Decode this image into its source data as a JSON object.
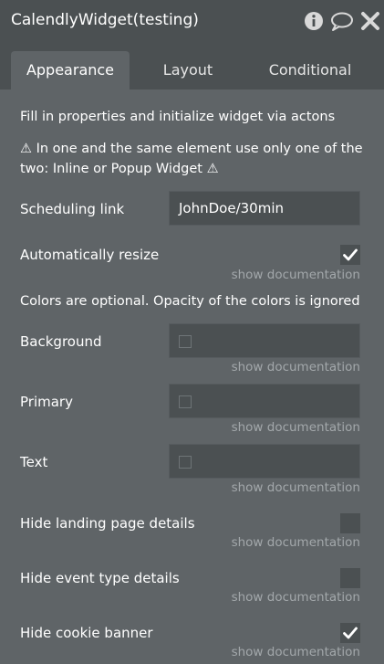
{
  "window": {
    "title": "CalendlyWidget(testing)",
    "icons": [
      "info-icon",
      "chat-icon",
      "close-icon"
    ]
  },
  "tabs": [
    {
      "label": "Appearance",
      "active": true
    },
    {
      "label": "Layout",
      "active": false
    },
    {
      "label": "Conditional",
      "active": false
    }
  ],
  "intro": {
    "line1": "Fill in properties and initialize widget via actons",
    "warning_line1": "⚠ In one and the same element use only one of the",
    "warning_line2": "two: Inline or Popup Widget ⚠"
  },
  "fields": {
    "scheduling_link": {
      "label": "Scheduling link",
      "value": "JohnDoe/30min"
    },
    "auto_resize": {
      "label": "Automatically resize",
      "checked": true,
      "doc": "show documentation"
    },
    "colors_note": "Colors are optional. Opacity of the colors is ignored",
    "background": {
      "label": "Background",
      "doc": "show documentation"
    },
    "primary": {
      "label": "Primary",
      "doc": "show documentation"
    },
    "text": {
      "label": "Text",
      "doc": "show documentation"
    },
    "hide_landing": {
      "label": "Hide landing page details",
      "checked": false,
      "doc": "show documentation"
    },
    "hide_event": {
      "label": "Hide event type details",
      "checked": false,
      "doc": "show documentation"
    },
    "hide_cookie": {
      "label": "Hide cookie banner",
      "checked": true,
      "doc": "show documentation"
    }
  },
  "colors": {
    "panel_bg": "#5f6467",
    "header_bg": "#4b5052",
    "input_bg": "#4b5052",
    "muted_text": "#a3a8ab"
  }
}
